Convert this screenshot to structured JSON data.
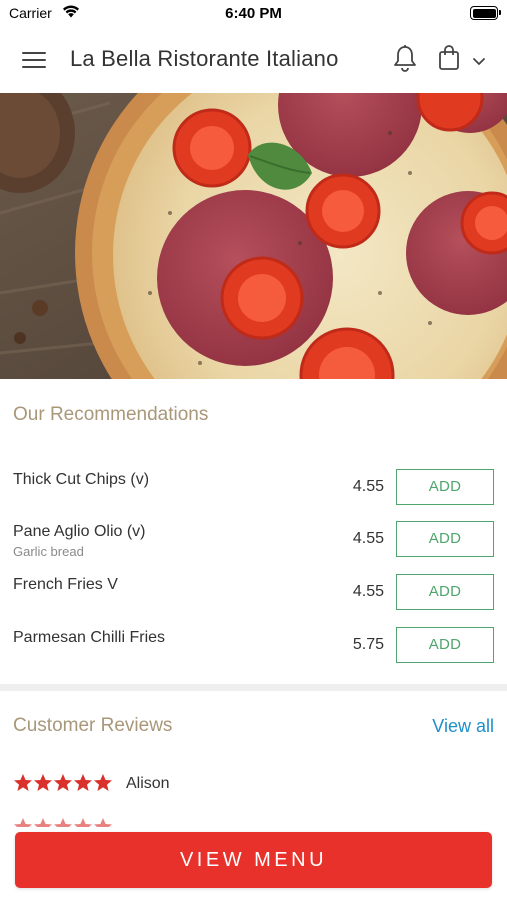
{
  "status_bar": {
    "carrier": "Carrier",
    "time": "6:40 PM",
    "wifi_icon": "wifi-icon",
    "battery_icon": "battery-icon"
  },
  "nav": {
    "title": "La Bella Ristorante Italiano",
    "menu_icon": "hamburger-icon",
    "notification_icon": "bell-icon",
    "cart_icon": "shopping-bag-icon",
    "dropdown_icon": "chevron-down-icon"
  },
  "hero": {
    "image": "pepperoni pizza with tomatoes and basil"
  },
  "recommendations": {
    "title": "Our Recommendations",
    "items": [
      {
        "name": "Thick Cut Chips (v)",
        "description": "",
        "price": "4.55",
        "add_label": "ADD"
      },
      {
        "name": "Pane Aglio Olio (v)",
        "description": "Garlic bread",
        "price": "4.55",
        "add_label": "ADD"
      },
      {
        "name": "French Fries V",
        "description": "",
        "price": "4.55",
        "add_label": "ADD"
      },
      {
        "name": "Parmesan Chilli Fries",
        "description": "",
        "price": "5.75",
        "add_label": "ADD"
      }
    ]
  },
  "reviews": {
    "title": "Customer Reviews",
    "view_all_label": "View all",
    "items": [
      {
        "reviewer": "Alison",
        "rating": 5
      }
    ]
  },
  "footer": {
    "view_menu_label": "VIEW MENU"
  },
  "colors": {
    "accent_red": "#e8312b",
    "add_green": "#4fa56d",
    "section_title": "#a9977a",
    "link_blue": "#1d8fc9",
    "star_red": "#d9302c"
  }
}
